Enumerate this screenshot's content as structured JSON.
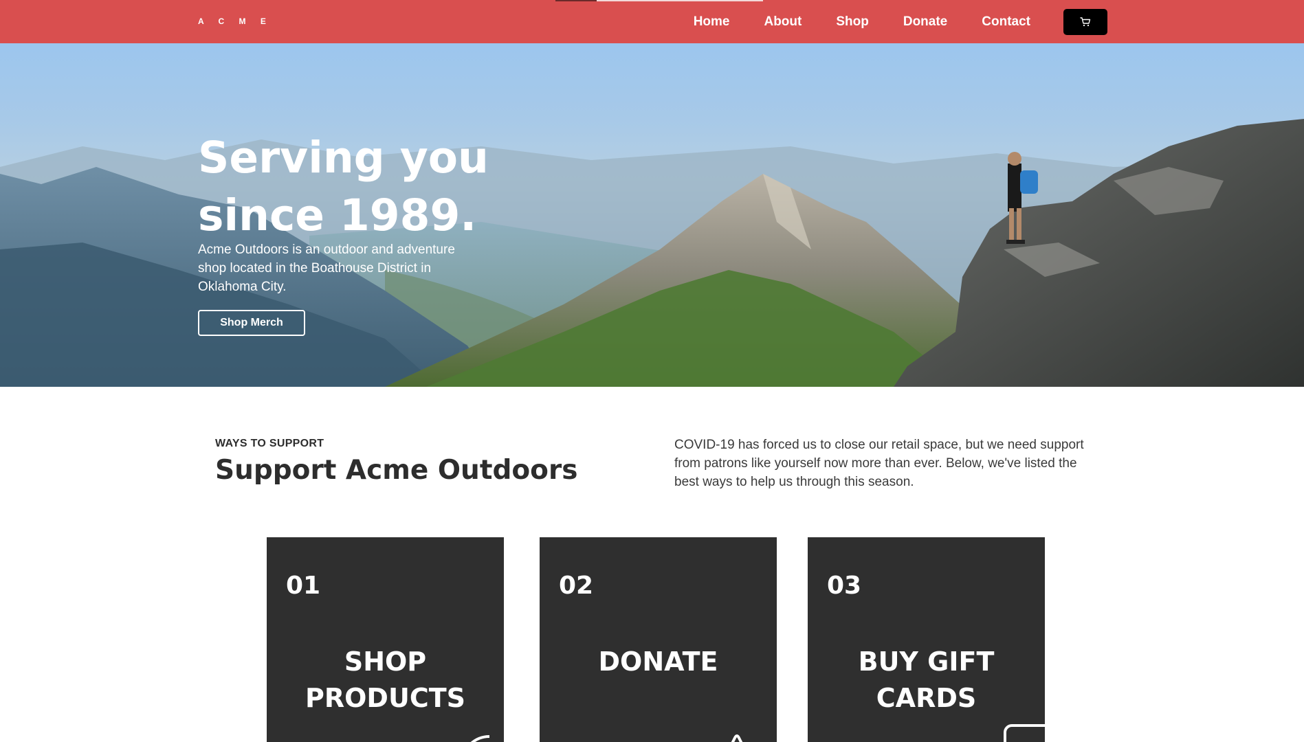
{
  "nav": {
    "logo": "A C M E",
    "links": [
      {
        "label": "Home"
      },
      {
        "label": "About"
      },
      {
        "label": "Shop"
      },
      {
        "label": "Donate"
      },
      {
        "label": "Contact"
      }
    ],
    "cart_icon": "cart-icon",
    "colors": {
      "background": "#d94f4f",
      "cart_button": "#000000"
    }
  },
  "hero": {
    "title_line1": "Serving you",
    "title_line2": "since 1989.",
    "subtitle": "Acme Outdoors is an outdoor and adventure shop located in the Boathouse District in Oklahoma City.",
    "button_label": "Shop Merch"
  },
  "support": {
    "eyebrow": "WAYS TO SUPPORT",
    "title": "Support Acme Outdoors",
    "description": "COVID-19 has forced us to close our retail space, but we need support from patrons like yourself now more than ever. Below, we've listed the best ways to help us through this season."
  },
  "cards": [
    {
      "number": "01",
      "title_line1": "SHOP",
      "title_line2": "PRODUCTS",
      "icon": "shopping-icon"
    },
    {
      "number": "02",
      "title_line1": "DONATE",
      "title_line2": "",
      "icon": "donate-icon"
    },
    {
      "number": "03",
      "title_line1": "BUY GIFT",
      "title_line2": "CARDS",
      "icon": "gift-card-icon"
    }
  ],
  "colors": {
    "card_background": "#2f2f2f",
    "text_dark": "#2d2d2d"
  }
}
